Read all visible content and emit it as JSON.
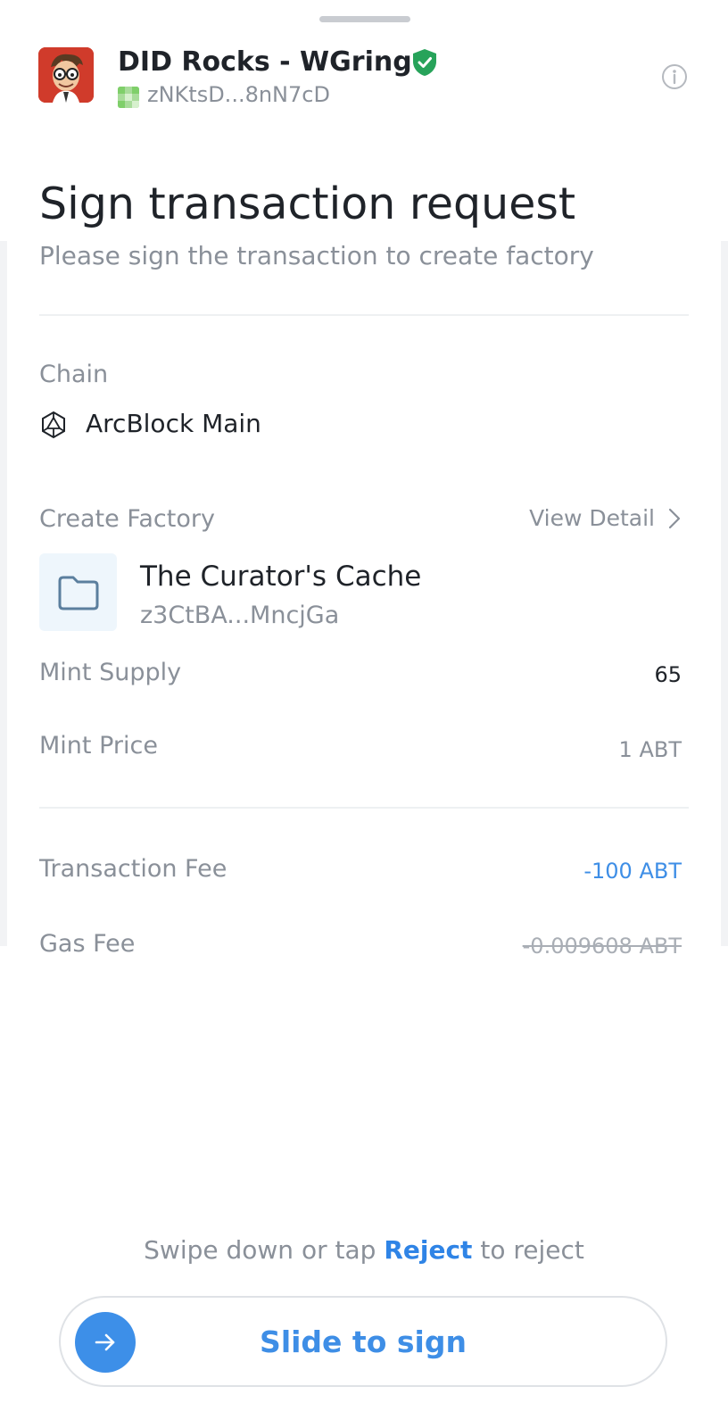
{
  "app": {
    "name": "DID Rocks - WGring",
    "did_short": "zNKtsD...8nN7cD",
    "logo_icon": "avatar-cartoon-icon",
    "verified_icon": "verified-shield-icon",
    "info_icon": "info-icon"
  },
  "title": "Sign transaction request",
  "subtitle": "Please sign the transaction to create factory",
  "chain": {
    "label": "Chain",
    "name": "ArcBlock Main",
    "icon": "arcblock-icon"
  },
  "factory": {
    "section_label": "Create Factory",
    "view_detail": "View Detail",
    "name": "The Curator's Cache",
    "address": "z3CtBA...MncjGa",
    "icon": "folder-icon"
  },
  "details": {
    "mint_supply_label": "Mint Supply",
    "mint_supply_value": "65",
    "mint_price_label": "Mint Price",
    "mint_price_value": "1 ABT"
  },
  "fees": {
    "transaction_fee_label": "Transaction Fee",
    "transaction_fee_value": "-100 ABT",
    "gas_fee_label": "Gas Fee",
    "gas_fee_value": "-0.009608 ABT"
  },
  "footer": {
    "hint_before": "Swipe down or tap ",
    "reject_label": "Reject",
    "hint_after": " to reject",
    "slide_label": "Slide to sign"
  },
  "colors": {
    "accent": "#3e8ee6",
    "verified": "#27a35a",
    "text_primary": "#1f2329",
    "text_secondary": "#8a9099"
  }
}
